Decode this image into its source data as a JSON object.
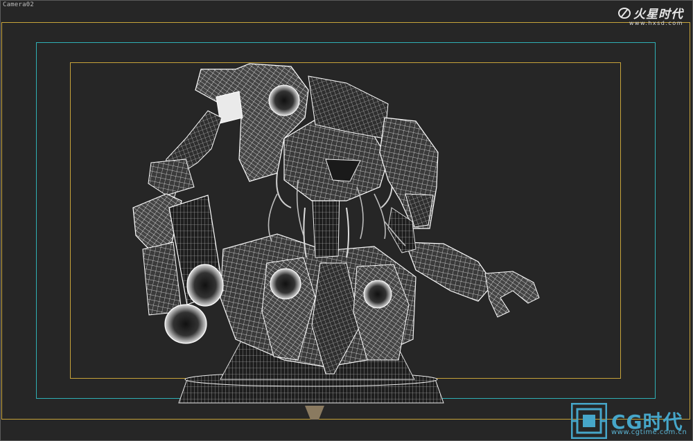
{
  "viewport": {
    "label": "Camera02"
  },
  "watermark_top": {
    "text": "火星时代",
    "url": "www.hxsd.com"
  },
  "watermark_bottom": {
    "text": "CG时代",
    "url": "www.cgtime.com.cn"
  },
  "colors": {
    "background": "#262626",
    "render_frame": "#c8a43a",
    "safe_frame": "#2fb1b6",
    "wireframe": "#ffffff",
    "brand_blue": "#46a6c9"
  }
}
